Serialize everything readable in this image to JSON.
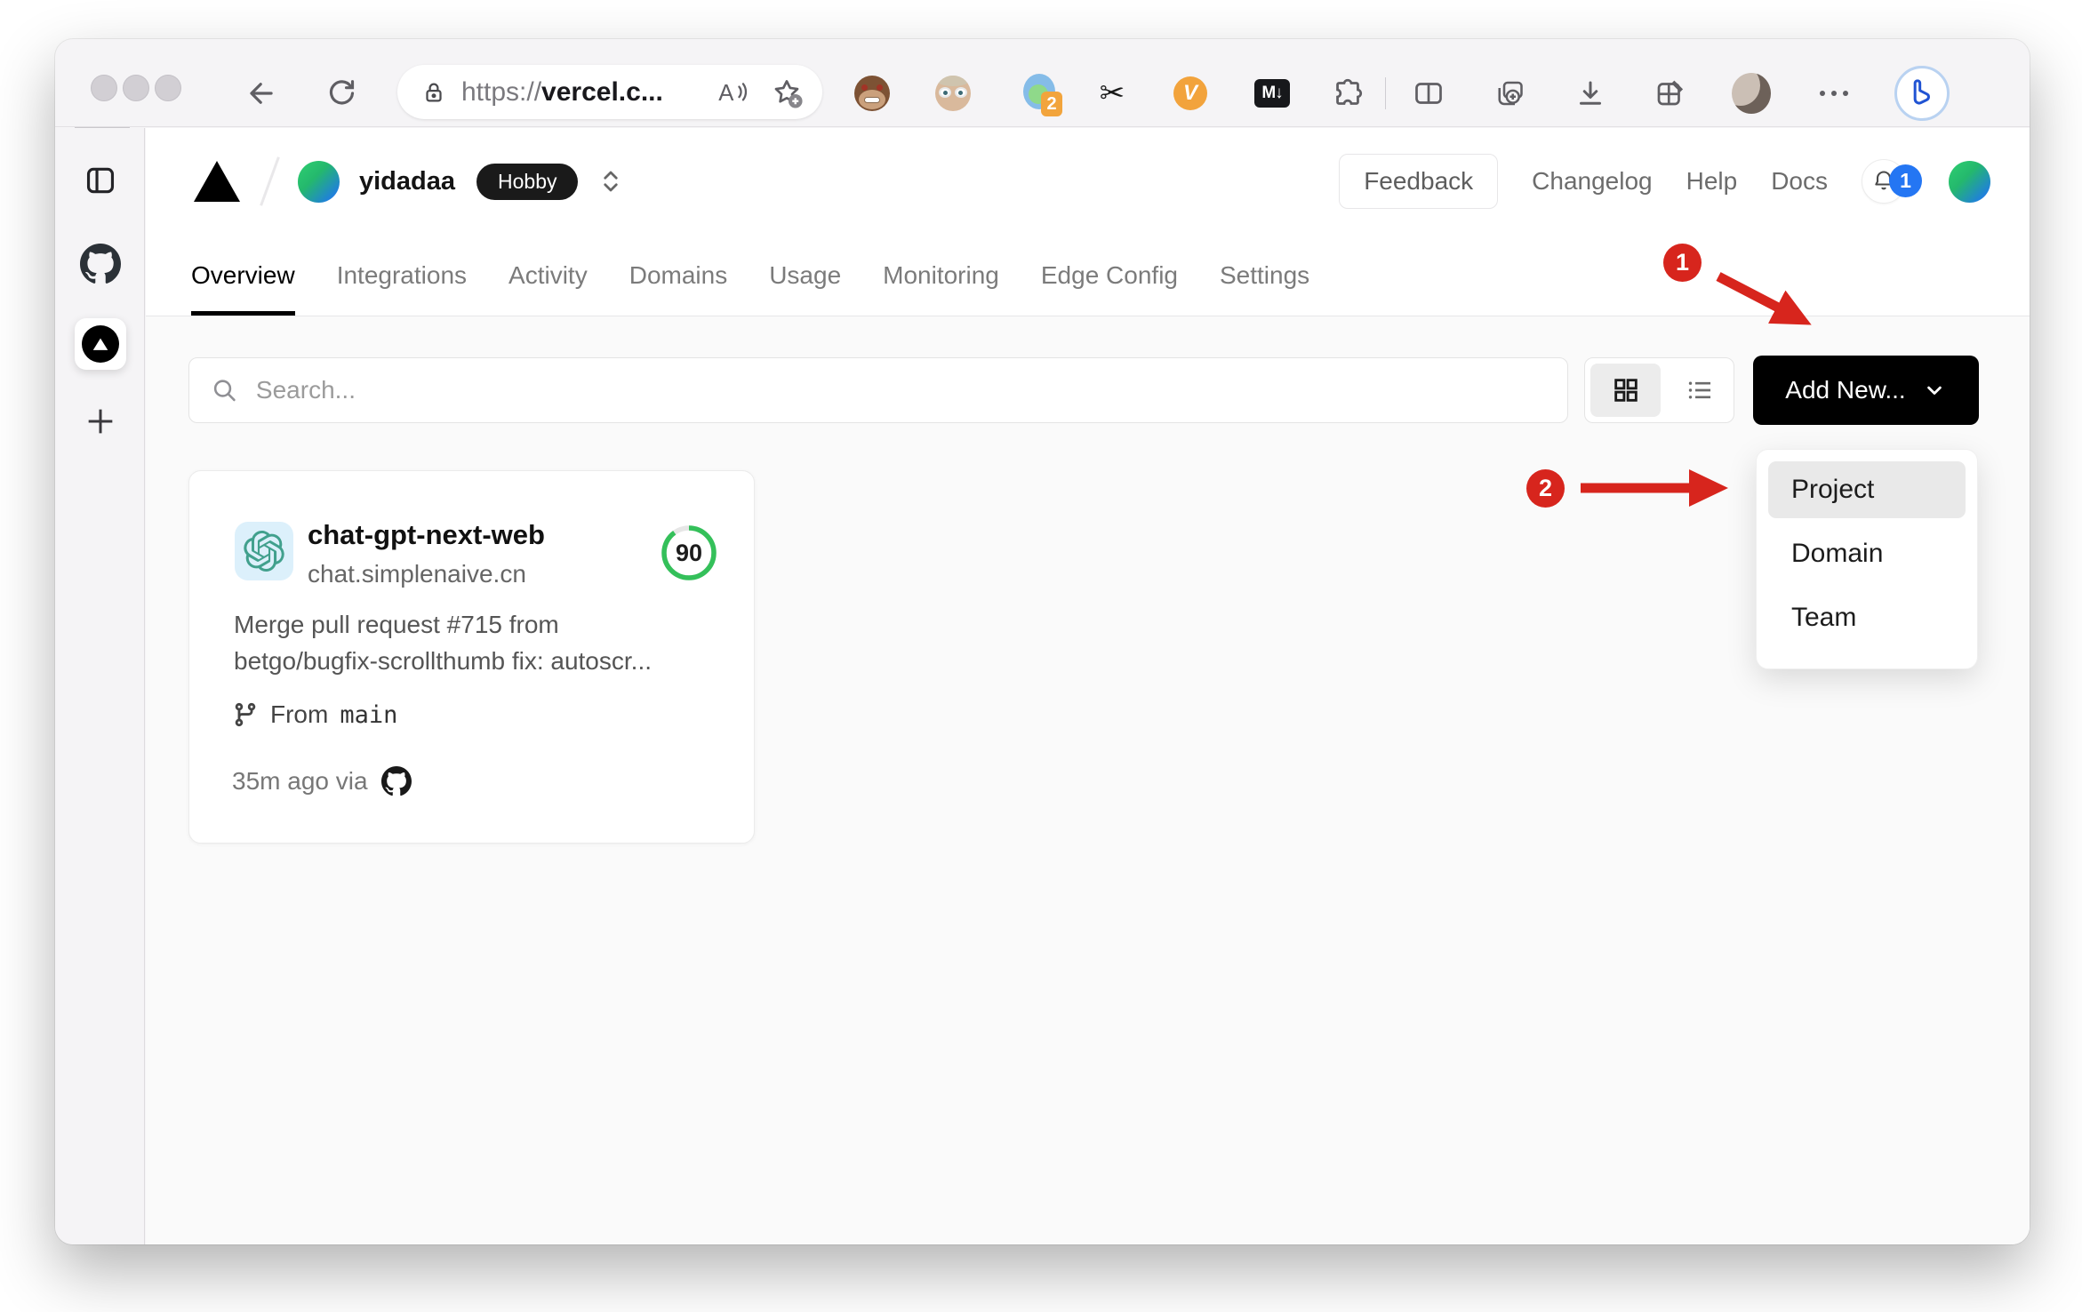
{
  "browser": {
    "url_scheme": "https://",
    "url_host": "vercel.c...",
    "extensions": {
      "proxy_badge": "2",
      "v_label": "V",
      "markdown_label": "M↓"
    }
  },
  "header": {
    "team_name": "yidadaa",
    "plan_badge": "Hobby",
    "feedback_label": "Feedback",
    "links": [
      "Changelog",
      "Help",
      "Docs"
    ],
    "notification_count": "1"
  },
  "tabs": [
    "Overview",
    "Integrations",
    "Activity",
    "Domains",
    "Usage",
    "Monitoring",
    "Edge Config",
    "Settings"
  ],
  "toolbar_row": {
    "search_placeholder": "Search...",
    "add_new_label": "Add New..."
  },
  "project_card": {
    "name": "chat-gpt-next-web",
    "domain": "chat.simplenaive.cn",
    "score": "90",
    "commit_line1": "Merge pull request #715 from",
    "commit_line2": "betgo/bugfix-scrollthumb fix: autoscr...",
    "branch_label": "From",
    "branch_name": "main",
    "deploy_meta": "35m ago via"
  },
  "dropdown": {
    "items": [
      "Project",
      "Domain",
      "Team"
    ],
    "highlighted": "Project"
  },
  "annotations": {
    "step1": "1",
    "step2": "2"
  },
  "colors": {
    "annotation_red": "#D7251D",
    "score_green": "#34C05A",
    "badge_blue": "#2476F3",
    "openai_teal": "#41A08D",
    "accent_black": "#000000"
  }
}
